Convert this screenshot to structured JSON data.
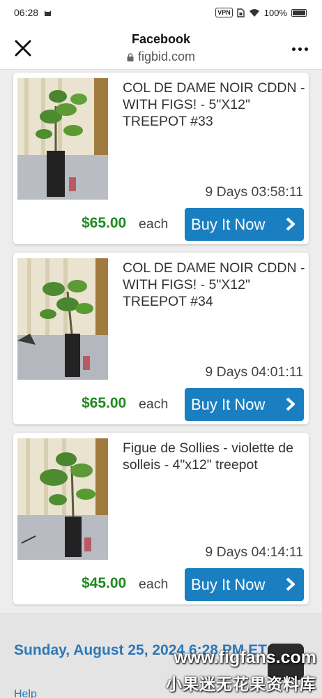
{
  "status_bar": {
    "time": "06:28",
    "vpn": "VPN",
    "battery": "100%"
  },
  "browser": {
    "title": "Facebook",
    "url": "figbid.com"
  },
  "listings": [
    {
      "title": "COL DE DAME NOIR CDDN - WITH FIGS! - 5\"X12\" TREEPOT #33",
      "time_left": "9 Days 03:58:11",
      "price": "$65.00",
      "unit": "each",
      "button": "Buy It Now"
    },
    {
      "title": "COL DE DAME NOIR CDDN - WITH FIGS! - 5\"X12\" TREEPOT #34",
      "time_left": "9 Days 04:01:11",
      "price": "$65.00",
      "unit": "each",
      "button": "Buy It Now"
    },
    {
      "title": "Figue de Sollies - violette de solleis - 4\"x12\" treepot",
      "time_left": "9 Days 04:14:11",
      "price": "$45.00",
      "unit": "each",
      "button": "Buy It Now"
    }
  ],
  "footer": {
    "datetime": "Sunday, August 25, 2024 6:28 PM ET",
    "help": "Help"
  },
  "watermark": {
    "line1": "www.figfans.com",
    "line2": "小果迷无花果资料库"
  },
  "colors": {
    "price": "#1f8a1f",
    "button": "#1a7fc1",
    "link": "#2c78b8"
  }
}
